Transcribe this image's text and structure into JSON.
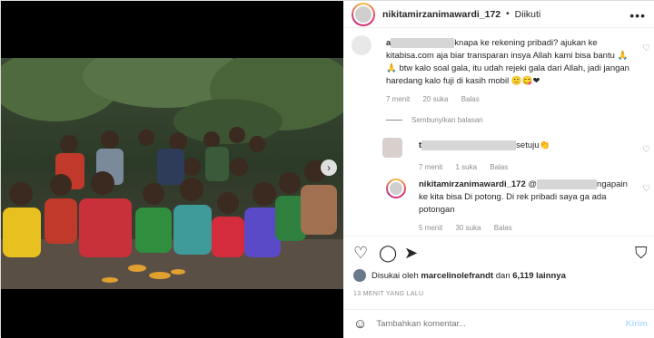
{
  "header": {
    "username": "nikitamirzanimawardi_172",
    "separator": "•",
    "follow_status": "Diikuti",
    "more_icon": "more-horizontal-icon"
  },
  "comments": [
    {
      "text_a": "a",
      "text_b": "knapa ke rekening pribadi? ajukan ke kitabisa.com aja biar transparan insya Allah kami bisa bantu 🙏🙏 btw kalo soal gala, itu udah rejeki gala dari Allah, jadi jangan haredang kalo fuji di kasih mobil 🙂😋❤",
      "time": "7 menit",
      "likes": "20 suka",
      "reply": "Balas"
    },
    {
      "text_a": "t",
      "text_b": "setuju👏",
      "time": "7 menit",
      "likes": "1 suka",
      "reply": "Balas"
    },
    {
      "user": "nikitamirzanimawardi_172",
      "text_a": "@",
      "text_b": "ngapain ke kita bisa Di potong. Di rek pribadi saya ga ada potongan",
      "time": "5 menit",
      "likes": "30 suka",
      "reply": "Balas"
    }
  ],
  "hide_replies": "Sembunyikan balasan",
  "liked_by": {
    "prefix": "Disukai oleh",
    "user": "marcelinolefrandt",
    "connector": "dan",
    "others": "6,119 lainnya"
  },
  "time_ago": "13 MENIT YANG LALU",
  "add_comment": {
    "placeholder": "Tambahkan komentar...",
    "post_label": "Kirim"
  },
  "carousel_next_glyph": "›",
  "colors": {
    "link_blue": "#b2dffc",
    "muted": "#8e8e8e",
    "text": "#262626",
    "like_heart": "#262626"
  }
}
